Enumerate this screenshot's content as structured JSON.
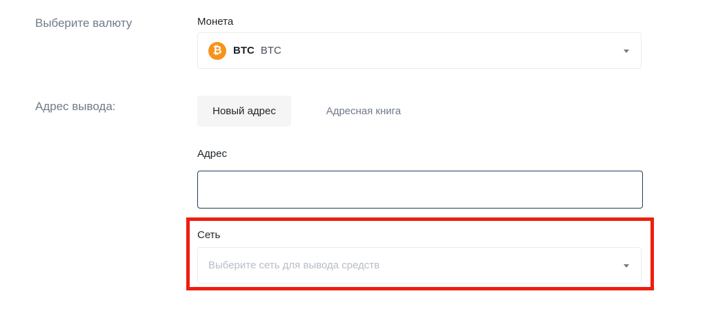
{
  "currency_section": {
    "label": "Выберите валюту",
    "coin_field_label": "Монета",
    "selected_coin": {
      "icon": "bitcoin-icon",
      "icon_glyph": "₿",
      "icon_color": "#f7931a",
      "symbol": "BTC",
      "name": "BTC"
    }
  },
  "address_section": {
    "label": "Адрес вывода:",
    "tabs": [
      {
        "label": "Новый адрес",
        "active": true
      },
      {
        "label": "Адресная книга",
        "active": false
      }
    ],
    "address_field_label": "Адрес",
    "address_value": "",
    "network_field_label": "Сеть",
    "network_placeholder": "Выберите сеть для вывода средств"
  },
  "colors": {
    "highlight": "#ee1e10",
    "input_border_focus": "#1f3a5a",
    "muted_text": "#707a8a"
  }
}
